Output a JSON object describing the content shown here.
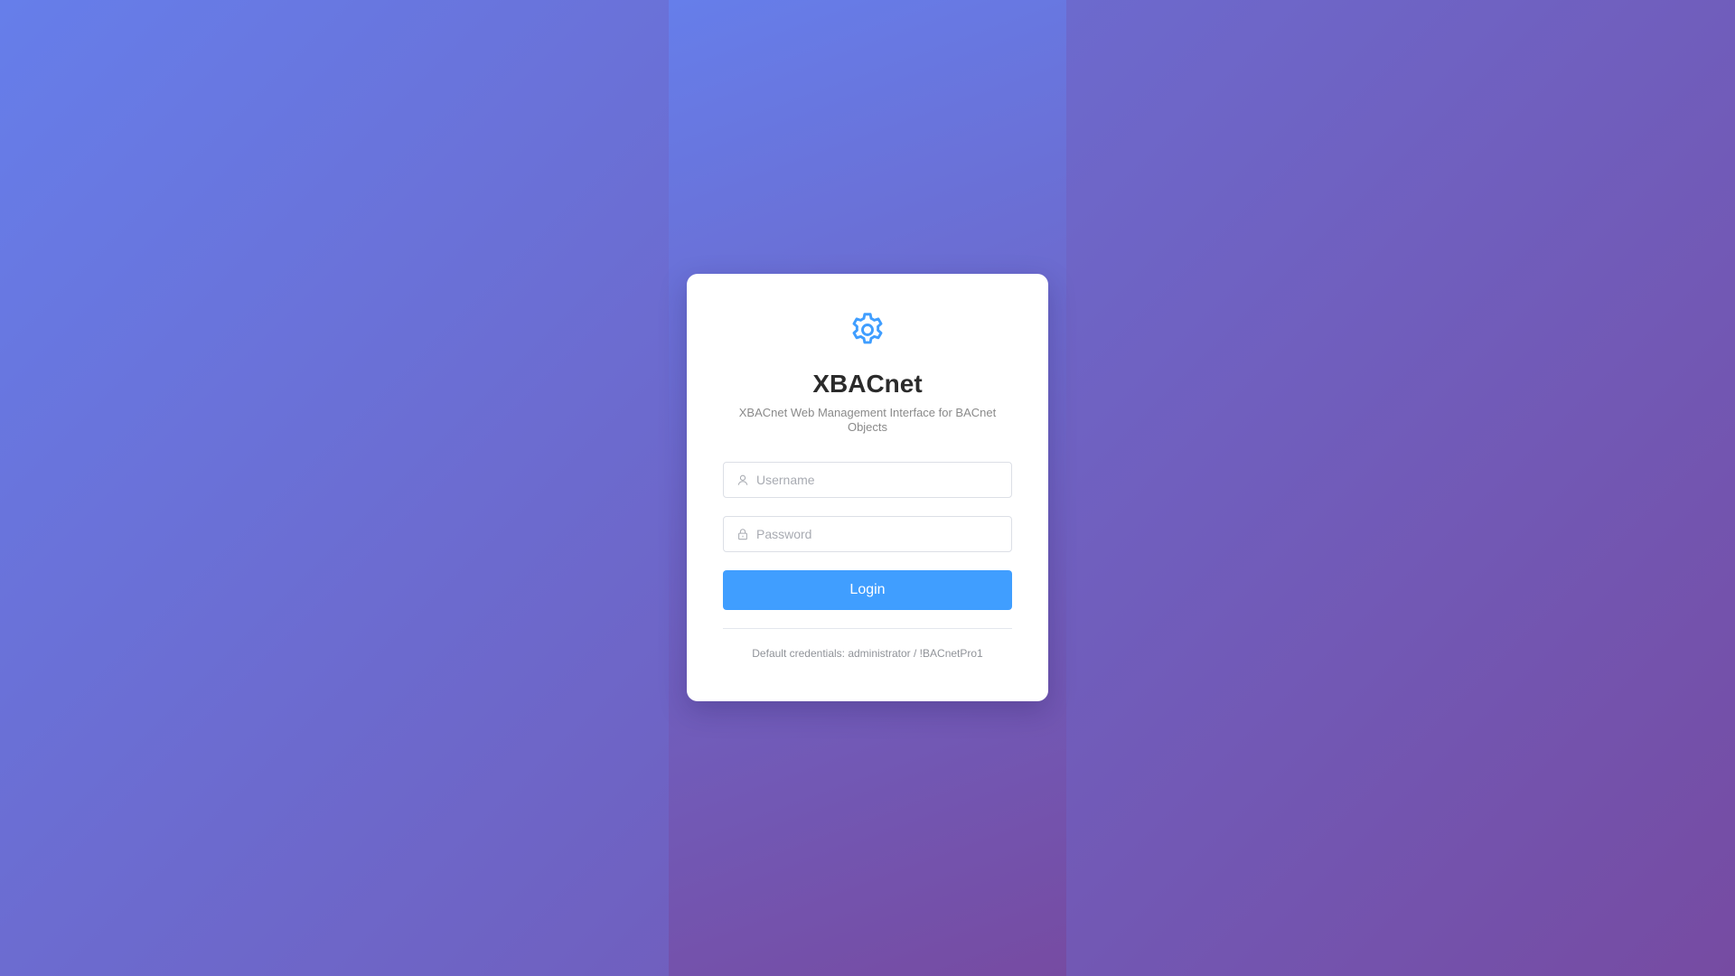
{
  "app": {
    "title": "XBACnet",
    "subtitle": "XBACnet Web Management Interface for BACnet Objects",
    "logo_icon": "gear-icon",
    "accent_color": "#409eff",
    "logo_color": "#409eff"
  },
  "form": {
    "username": {
      "icon": "user-icon",
      "placeholder": "Username",
      "value": ""
    },
    "password": {
      "icon": "lock-icon",
      "placeholder": "Password",
      "value": ""
    },
    "login_label": "Login"
  },
  "footer": {
    "hint": "Default credentials: administrator / !BACnetPro1"
  }
}
